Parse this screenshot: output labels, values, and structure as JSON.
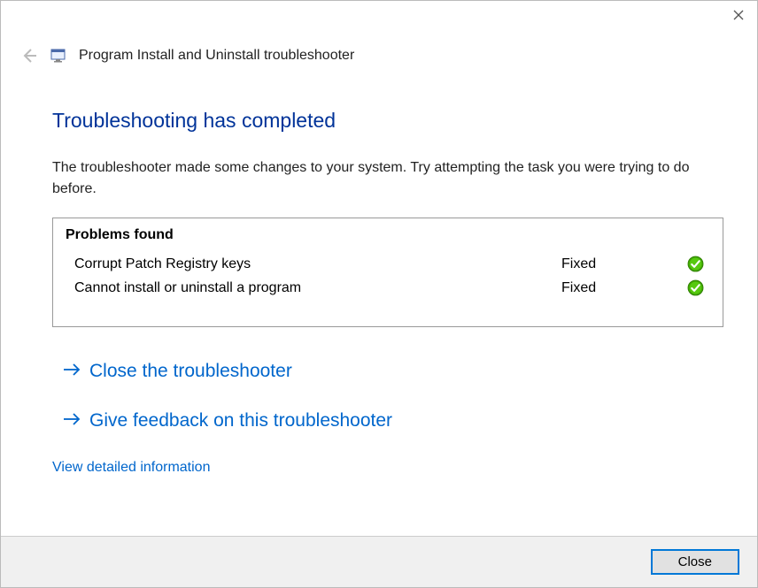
{
  "header": {
    "title": "Program Install and Uninstall troubleshooter"
  },
  "main": {
    "heading": "Troubleshooting has completed",
    "description": "The troubleshooter made some changes to your system. Try attempting the task you were trying to do before.",
    "problems_title": "Problems found",
    "problems": [
      {
        "name": "Corrupt Patch Registry keys",
        "status": "Fixed"
      },
      {
        "name": "Cannot install or uninstall a program",
        "status": "Fixed"
      }
    ],
    "actions": {
      "close_troubleshooter": "Close the troubleshooter",
      "give_feedback": "Give feedback on this troubleshooter"
    },
    "detail_link": "View detailed information"
  },
  "footer": {
    "close_button": "Close"
  }
}
